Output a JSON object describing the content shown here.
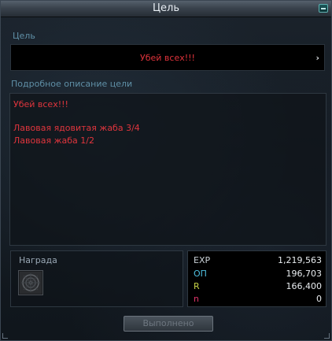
{
  "window": {
    "title": "Цель"
  },
  "goal": {
    "section_label": "Цель",
    "text": "Убей всех!!!",
    "arrow": "›"
  },
  "description": {
    "section_label": "Подробное описание цели",
    "lines": [
      "Убей всех!!!",
      "",
      "Лавовая ядовитая жаба 3/4",
      "Лавовая жаба 1/2"
    ]
  },
  "reward": {
    "label": "Награда",
    "item_icon": "reward-item-icon"
  },
  "stats": [
    {
      "name": "EXP",
      "value": "1,219,563",
      "color": "#c9d0d6"
    },
    {
      "name": "ОП",
      "value": "196,703",
      "color": "#4fc0e0"
    },
    {
      "name": "R",
      "value": "166,400",
      "color": "#c8d447"
    },
    {
      "name": "n",
      "value": "0",
      "color": "#e0346a"
    }
  ],
  "actions": {
    "done_label": "Выполнено"
  },
  "colors": {
    "goal_text": "#e0333b",
    "section_label": "#5f8fa6"
  }
}
